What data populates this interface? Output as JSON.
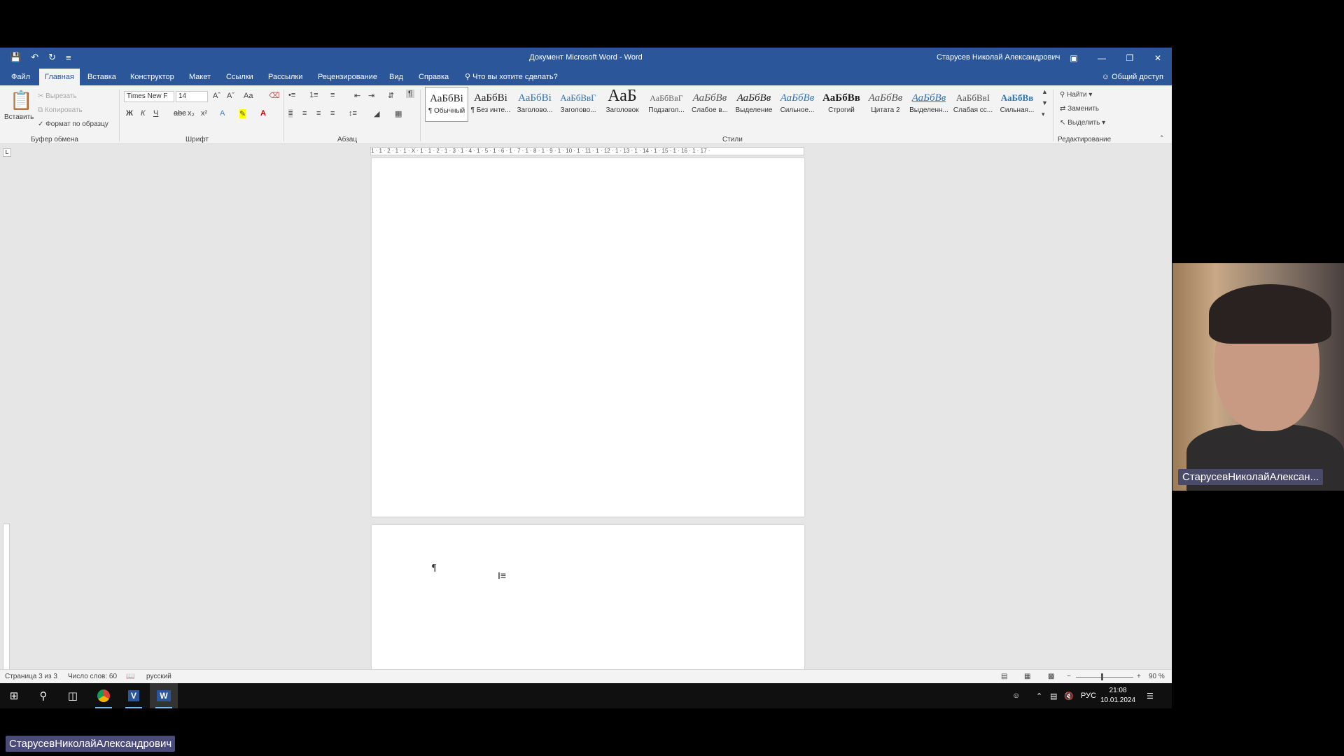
{
  "window": {
    "title": "Документ Microsoft Word  -  Word",
    "user": "Старусев Николай Александрович"
  },
  "tabs": [
    "Файл",
    "Главная",
    "Вставка",
    "Конструктор",
    "Макет",
    "Ссылки",
    "Рассылки",
    "Рецензирование",
    "Вид",
    "Справка"
  ],
  "tell_me": "Что вы хотите сделать?",
  "share": "Общий доступ",
  "clipboard": {
    "paste": "Вставить",
    "cut": "Вырезать",
    "copy": "Копировать",
    "format_painter": "Формат по образцу",
    "label": "Буфер обмена"
  },
  "font": {
    "name": "Times New F",
    "size": "14",
    "label": "Шрифт",
    "case": "Aa"
  },
  "paragraph": {
    "label": "Абзац"
  },
  "styles": {
    "label": "Стили",
    "items": [
      {
        "sample": "АаБбВі",
        "name": "¶ Обычный"
      },
      {
        "sample": "АаБбВі",
        "name": "¶ Без инте..."
      },
      {
        "sample": "АаБбВі",
        "name": "Заголово..."
      },
      {
        "sample": "АаБбВвГ",
        "name": "Заголово..."
      },
      {
        "sample": "АаБ",
        "name": "Заголовок"
      },
      {
        "sample": "АаБбВвГ",
        "name": "Подзагол..."
      },
      {
        "sample": "АаБбВв",
        "name": "Слабое в..."
      },
      {
        "sample": "АаБбВв",
        "name": "Выделение"
      },
      {
        "sample": "АаБбВв",
        "name": "Сильное..."
      },
      {
        "sample": "АаБбВв",
        "name": "Строгий"
      },
      {
        "sample": "АаБбВв",
        "name": "Цитата 2"
      },
      {
        "sample": "АаБбВв",
        "name": "Выделенн..."
      },
      {
        "sample": "АаБбВвІ",
        "name": "Слабая сс..."
      },
      {
        "sample": "АаБбВв",
        "name": "Сильная..."
      }
    ]
  },
  "editing": {
    "find": "Найти",
    "replace": "Заменить",
    "select": "Выделить",
    "label": "Редактирование"
  },
  "ruler": "1 · 1 · 2 · 1 · 1 · X · 1 · 1 · 2 · 1 · 3 · 1 · 4 · 1 · 5 · 1 · 6 · 1 · 7 · 1 · 8 · 1 · 9 · 1 · 10 · 1 · 11 · 1 · 12 · 1 · 13 · 1 · 14 · 1 · 15 · 1 · 16 · 1 · 17 ·",
  "document": {
    "pilcrow": "¶"
  },
  "status": {
    "page": "Страница 3 из 3",
    "words": "Число слов: 60",
    "language": "русский",
    "zoom": "90 %",
    "zoom_percent": 90
  },
  "taskbar": {
    "lang": "РУС",
    "time": "21:08",
    "date": "10.01.2024"
  },
  "webcam": {
    "name": "СтарусевНиколайАлексан..."
  },
  "presenter": "СтарусевНиколайАлександрович"
}
